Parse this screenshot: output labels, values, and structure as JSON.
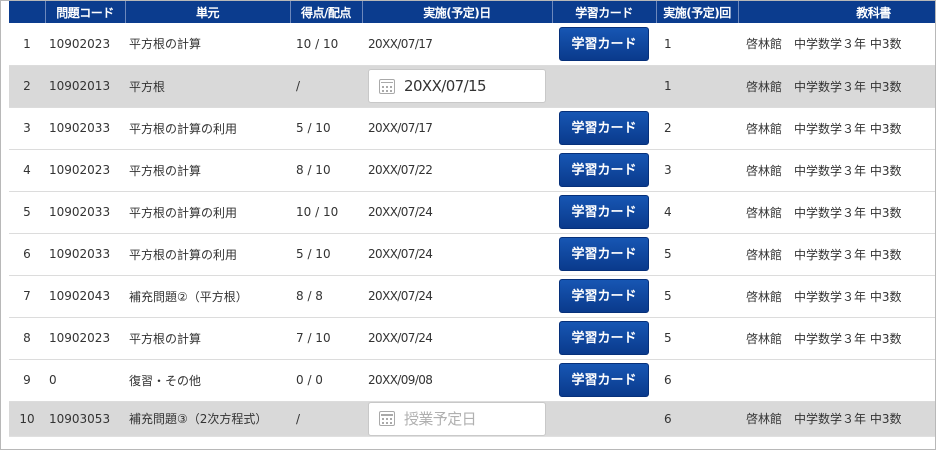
{
  "columns": {
    "no": "",
    "code": "問題コード",
    "unit": "単元",
    "score": "得点/配点",
    "date": "実施(予定)日",
    "card": "学習カード",
    "round": "実施(予定)回",
    "book": "教科書"
  },
  "rows": [
    {
      "no": "1",
      "code": "10902023",
      "unit": "平方根の計算",
      "score": "10 / 10",
      "date": "20XX/07/17",
      "card": "学習カード",
      "round": "1",
      "book": "啓林館　中学数学３年 中3数"
    },
    {
      "no": "2",
      "code": "10902013",
      "unit": "平方根",
      "score": "/",
      "date_input": {
        "value": "20XX/07/15",
        "placeholder": ""
      },
      "card": "",
      "round": "1",
      "book": "啓林館　中学数学３年 中3数"
    },
    {
      "no": "3",
      "code": "10902033",
      "unit": "平方根の計算の利用",
      "score": "5 / 10",
      "date": "20XX/07/17",
      "card": "学習カード",
      "round": "2",
      "book": "啓林館　中学数学３年 中3数"
    },
    {
      "no": "4",
      "code": "10902023",
      "unit": "平方根の計算",
      "score": "8 / 10",
      "date": "20XX/07/22",
      "card": "学習カード",
      "round": "3",
      "book": "啓林館　中学数学３年 中3数"
    },
    {
      "no": "5",
      "code": "10902033",
      "unit": "平方根の計算の利用",
      "score": "10 / 10",
      "date": "20XX/07/24",
      "card": "学習カード",
      "round": "4",
      "book": "啓林館　中学数学３年 中3数"
    },
    {
      "no": "6",
      "code": "10902033",
      "unit": "平方根の計算の利用",
      "score": "5 / 10",
      "date": "20XX/07/24",
      "card": "学習カード",
      "round": "5",
      "book": "啓林館　中学数学３年 中3数"
    },
    {
      "no": "7",
      "code": "10902043",
      "unit": "補充問題②（平方根）",
      "score": "8 / 8",
      "date": "20XX/07/24",
      "card": "学習カード",
      "round": "5",
      "book": "啓林館　中学数学３年 中3数"
    },
    {
      "no": "8",
      "code": "10902023",
      "unit": "平方根の計算",
      "score": "7 / 10",
      "date": "20XX/07/24",
      "card": "学習カード",
      "round": "5",
      "book": "啓林館　中学数学３年 中3数"
    },
    {
      "no": "9",
      "code": "0",
      "unit": "復習・その他",
      "score": "0 / 0",
      "date": "20XX/09/08",
      "card": "学習カード",
      "round": "6",
      "book": ""
    },
    {
      "no": "10",
      "code": "10903053",
      "unit": "補充問題③（2次方程式）",
      "score": "/",
      "date_input": {
        "value": "",
        "placeholder": "授業予定日"
      },
      "card": "",
      "round": "6",
      "book": "啓林館　中学数学３年 中3数"
    }
  ],
  "colors": {
    "header_bg": "#0b3c8e",
    "button_bg": "#0e47a1",
    "gray_row": "#d9d9d9"
  },
  "icons": {
    "date_input": "calendar-icon"
  }
}
